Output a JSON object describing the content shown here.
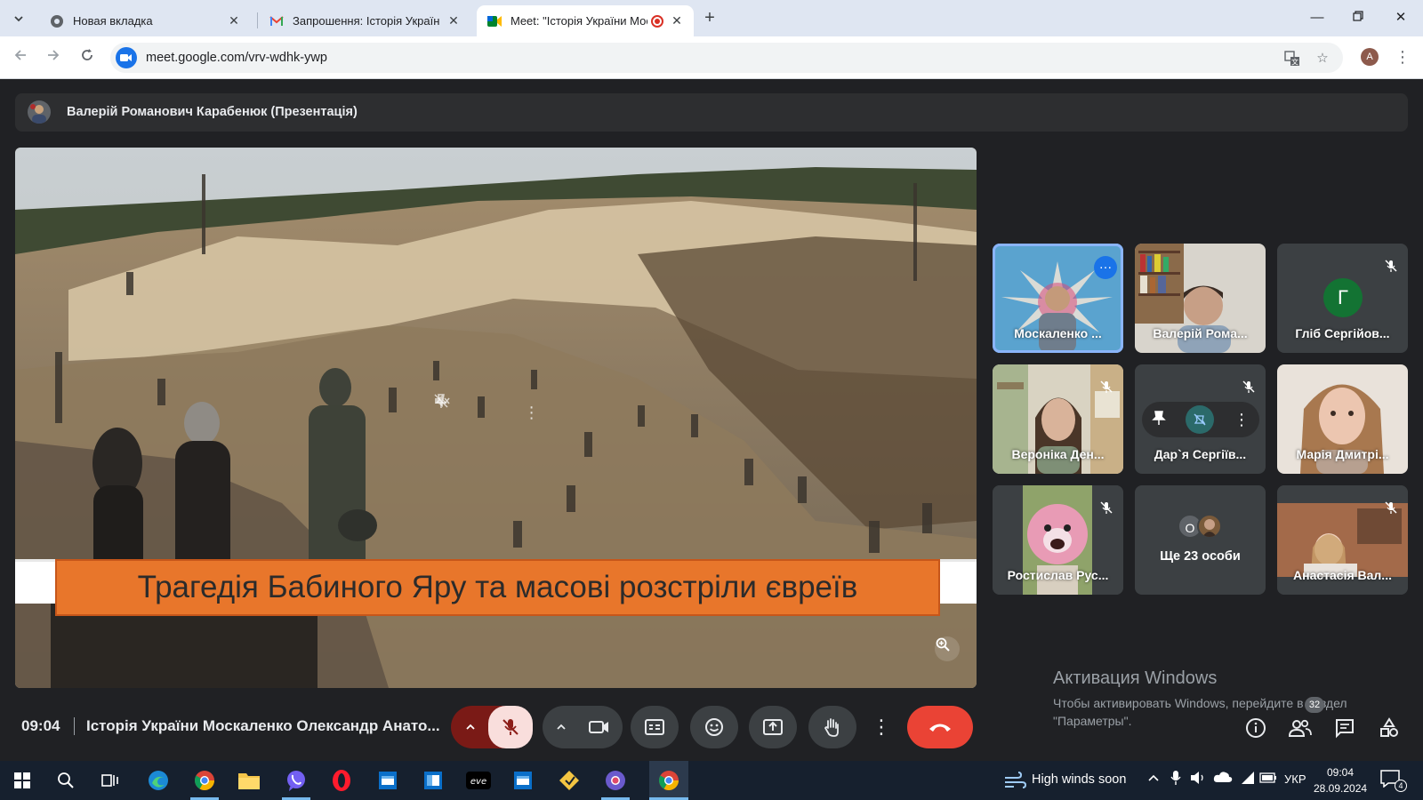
{
  "browser": {
    "tabs": [
      {
        "title": "Новая вкладка",
        "icon": "chrome-icon",
        "active": false
      },
      {
        "title": "Запрошення: Історія України М",
        "icon": "gmail-icon",
        "active": false
      },
      {
        "title": "Meet: \"Історія України Мос",
        "icon": "meet-icon",
        "active": true
      }
    ],
    "url": "meet.google.com/vrv-wdhk-ywp",
    "profile_initial": "A"
  },
  "meet": {
    "presenter_label": "Валерій Романович Карабенюк (Презентація)",
    "slide_caption": "Трагедія Бабиного Яру та масові розстріли євреїв",
    "participants": [
      {
        "name": "Москаленко ...",
        "speaking": true,
        "muted": false
      },
      {
        "name": "Валерій Рома...",
        "speaking": false,
        "muted": false
      },
      {
        "name": "Гліб Сергійов...",
        "avatar_letter": "Г",
        "muted": true
      },
      {
        "name": "Вероніка Ден...",
        "muted": true
      },
      {
        "name": "Дар`я Сергіїв...",
        "muted": true
      },
      {
        "name": "Марія Дмитрі...",
        "muted": false
      },
      {
        "name": "Ростислав Рус...",
        "muted": true
      },
      {
        "name": "Ще 23 особи",
        "count_initial": "О"
      },
      {
        "name": "Анастасія Вал...",
        "muted": true
      }
    ],
    "time": "09:04",
    "meeting_title": "Історія України Москаленко Олександр Анато...",
    "people_count": "32"
  },
  "watermark": {
    "title": "Активация Windows",
    "line1": "Чтобы активировать Windows, перейдите в раздел",
    "line2": "\"Параметры\"."
  },
  "taskbar": {
    "weather": "High winds soon",
    "language": "УКР",
    "time": "09:04",
    "date": "28.09.2024",
    "notifications": "4"
  },
  "colors": {
    "meet_bg": "#202124",
    "hangup": "#ea4335",
    "caption_orange": "#e8762b",
    "speaking_outline": "#8ab4f8"
  }
}
